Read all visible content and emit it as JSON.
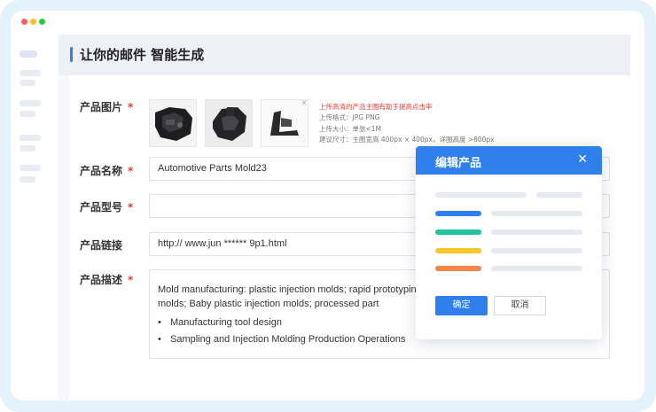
{
  "window": {
    "controls": [
      {
        "name": "close",
        "color": "#ff5f57"
      },
      {
        "name": "minimize",
        "color": "#febc2e"
      },
      {
        "name": "maximize",
        "color": "#28c840"
      }
    ]
  },
  "page": {
    "title": "让你的邮件 智能生成"
  },
  "form": {
    "image": {
      "label": "产品图片",
      "required": "*",
      "tip_main": "上传高清的产品主图有助于提高点击率",
      "tip_format": "上传格式：JPG  PNG",
      "tip_size": "上传大小：单张<1M",
      "tip_dimension": "建议尺寸：主图宽高 400px × 400px，详图高度 >800px",
      "remove_icon": "×"
    },
    "name": {
      "label": "产品名称",
      "required": "*",
      "value": "Automotive Parts Mold23"
    },
    "model": {
      "label": "产品型号",
      "required": "*",
      "value": ""
    },
    "link": {
      "label": "产品链接",
      "value": "http:// www.jun ****** 9p1.html"
    },
    "description": {
      "label": "产品描述",
      "required": "*",
      "paragraph": "Mold manufacturing: plastic injection molds; rapid prototyping molds; Baby plastic injection molds; processed part",
      "bullets": [
        "Manufacturing tool design",
        "Sampling and Injection Molding Production Operations"
      ],
      "bullet_glyph": "•"
    }
  },
  "modal": {
    "title": "编辑产品",
    "close_icon": "✕",
    "confirm_label": "确定",
    "cancel_label": "取消",
    "accent_colors": [
      "#2f80ed",
      "#22c39a",
      "#f6c82a",
      "#f2874a"
    ]
  }
}
